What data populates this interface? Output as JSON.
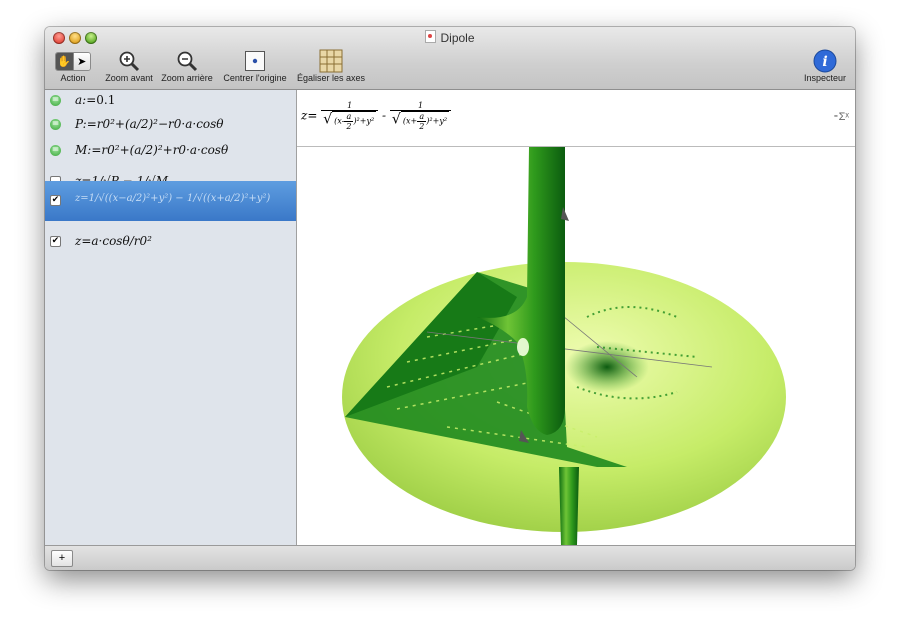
{
  "window": {
    "title": "Dipole"
  },
  "toolbar": {
    "action": "Action",
    "zoom_in": "Zoom avant",
    "zoom_out": "Zoom arrière",
    "center": "Centrer l'origine",
    "equalize": "Égaliser les axes",
    "inspector": "Inspecteur"
  },
  "equations": [
    {
      "kind": "definition",
      "lead": "=",
      "lhs": "a:=",
      "rhs": "0.1"
    },
    {
      "kind": "definition",
      "lead": "=",
      "lhs": "P:=",
      "rhs": "r0²+(a/2)²−r0·a·cosθ"
    },
    {
      "kind": "definition",
      "lead": "=",
      "lhs": "M:=",
      "rhs": "r0²+(a/2)²+r0·a·cosθ"
    },
    {
      "kind": "graph",
      "checked": false,
      "lhs": "z=",
      "rhs": "1/√P − 1/√M"
    },
    {
      "kind": "graph",
      "checked": true,
      "selected": true,
      "lhs": "z=",
      "rhs": "1/√((x−a/2)²+y²) − 1/√((x+a/2)²+y²)"
    },
    {
      "kind": "graph",
      "checked": true,
      "lhs": "z=",
      "rhs": "a·cosθ/r0²"
    }
  ],
  "header_formula": {
    "lhs": "z=",
    "one": "1",
    "minus": "-",
    "x_minus": "x-",
    "x_plus": "x+",
    "a": "a",
    "two": "2",
    "y2": "+y²"
  },
  "sigma_label": "⁃Σˣ",
  "bottom": {
    "add": "+"
  },
  "colors": {
    "surface_light": "#c9f06b",
    "surface_dark": "#1e8a1e",
    "selection": "#3a78c8"
  }
}
